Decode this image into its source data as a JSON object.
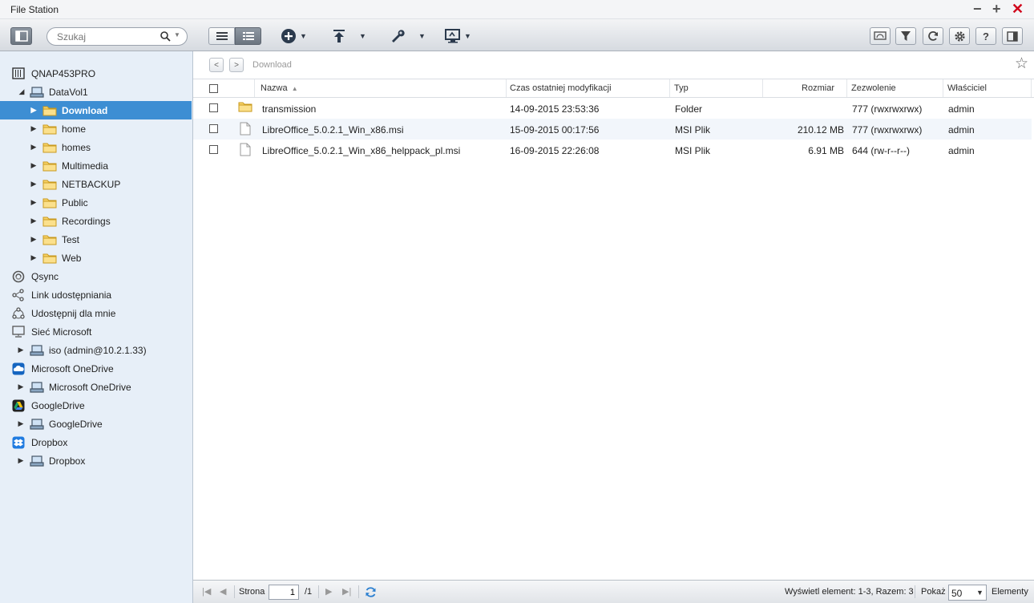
{
  "window": {
    "title": "File Station",
    "min_glyph": "−",
    "max_glyph": "+",
    "close_glyph": "✕"
  },
  "toolbar": {
    "search_placeholder": "Szukaj",
    "icons": [
      "sidebar-toggle-icon",
      "search-icon",
      "list-view-icon",
      "detail-view-icon",
      "add-icon",
      "upload-icon",
      "tools-icon",
      "share-screen-icon",
      "remote-mount-icon",
      "filter-icon",
      "refresh-icon",
      "settings-icon",
      "help-icon",
      "panel-icon"
    ]
  },
  "sidebar": {
    "nas": "QNAP453PRO",
    "volume": "DataVol1",
    "folders": [
      "Download",
      "home",
      "homes",
      "Multimedia",
      "NETBACKUP",
      "Public",
      "Recordings",
      "Test",
      "Web"
    ],
    "selected_folder": "Download",
    "qsync": "Qsync",
    "share_link": "Link udostępniania",
    "shared_with_me": "Udostępnij dla mnie",
    "ms_network": "Sieć Microsoft",
    "ms_network_child": "iso (admin@10.2.1.33)",
    "onedrive": "Microsoft OneDrive",
    "onedrive_child": "Microsoft OneDrive",
    "googledrive": "GoogleDrive",
    "googledrive_child": "GoogleDrive",
    "dropbox": "Dropbox",
    "dropbox_child": "Dropbox",
    "colors": {
      "background": "#e7eff8",
      "selected": "#3d8ed3"
    }
  },
  "pathbar": {
    "back": "<",
    "forward": ">",
    "path": "Download",
    "star": "☆"
  },
  "grid": {
    "columns": {
      "name": "Nazwa",
      "sort_arrow": "▲",
      "modified": "Czas ostatniej modyfikacji",
      "type": "Typ",
      "size": "Rozmiar",
      "permission": "Zezwolenie",
      "owner": "Właściciel"
    },
    "rows": [
      {
        "name": "transmission",
        "modified": "14-09-2015 23:53:36",
        "type": "Folder",
        "size": "",
        "permission": "777 (rwxrwxrwx)",
        "owner": "admin",
        "icon": "folder-icon"
      },
      {
        "name": "LibreOffice_5.0.2.1_Win_x86.msi",
        "modified": "15-09-2015 00:17:56",
        "type": "MSI Plik",
        "size": "210.12 MB",
        "permission": "777 (rwxrwxrwx)",
        "owner": "admin",
        "icon": "file-icon"
      },
      {
        "name": "LibreOffice_5.0.2.1_Win_x86_helppack_pl.msi",
        "modified": "16-09-2015 22:26:08",
        "type": "MSI Plik",
        "size": "6.91 MB",
        "permission": "644 (rw-r--r--)",
        "owner": "admin",
        "icon": "file-icon"
      }
    ]
  },
  "footer": {
    "page_label": "Strona",
    "page_value": "1",
    "page_total": "/1",
    "summary": "Wyświetl element: 1-3, Razem: 3",
    "show_label": "Pokaż",
    "page_size": "50",
    "items_label": "Elementy"
  }
}
